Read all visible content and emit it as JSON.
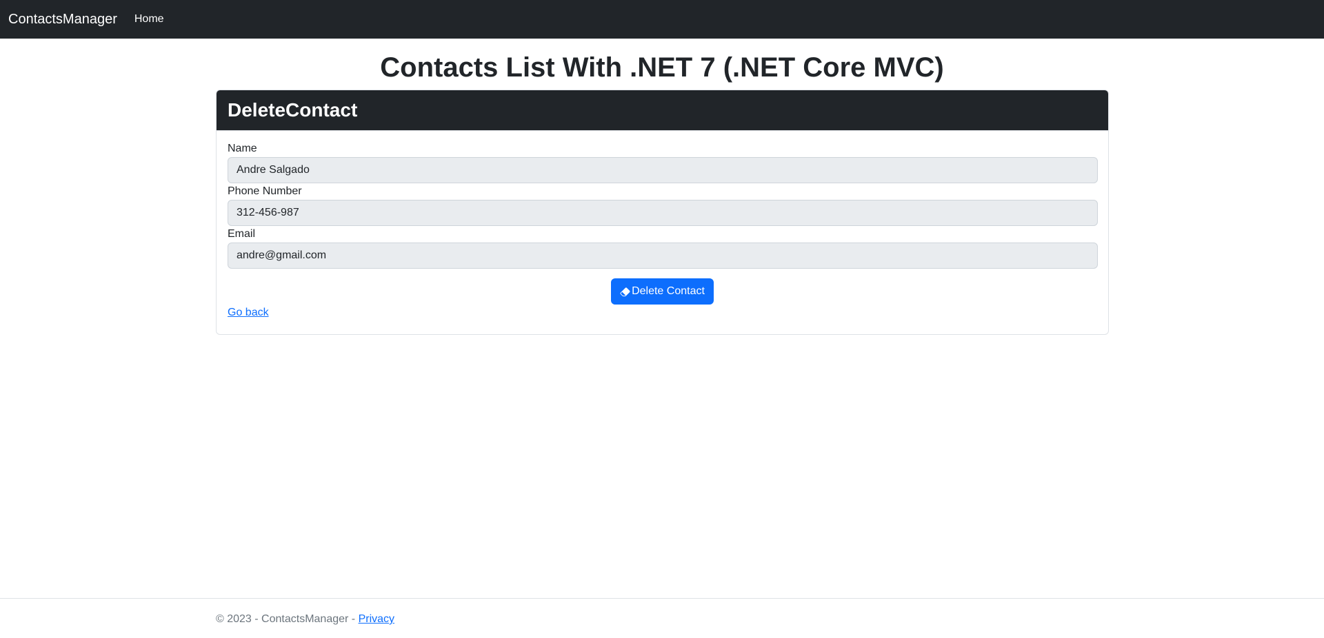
{
  "navbar": {
    "brand": "ContactsManager",
    "links": [
      {
        "label": "Home"
      }
    ]
  },
  "page": {
    "title": "Contacts List With .NET 7 (.NET Core MVC)"
  },
  "card": {
    "header": "DeleteContact",
    "fields": {
      "name": {
        "label": "Name",
        "value": "Andre Salgado"
      },
      "phone": {
        "label": "Phone Number",
        "value": "312-456-987"
      },
      "email": {
        "label": "Email",
        "value": "andre@gmail.com"
      }
    },
    "delete_button_label": "Delete Contact",
    "delete_button_icon": "eraser-icon",
    "go_back_label": "Go back"
  },
  "footer": {
    "copyright": "© 2023 - ContactsManager - ",
    "privacy_label": "Privacy"
  },
  "colors": {
    "navbar_bg": "#212529",
    "primary": "#0d6efd",
    "input_bg": "#e9ecef"
  }
}
